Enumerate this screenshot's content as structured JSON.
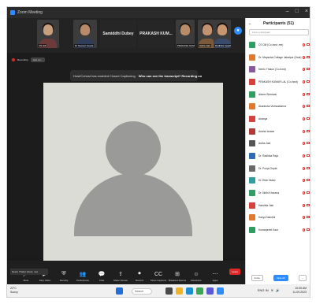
{
  "window": {
    "title": "Zoom Meeting",
    "controls": [
      "–",
      "□",
      "×"
    ]
  },
  "strip": {
    "thumbs": [
      {
        "label": "CS Gill",
        "face": "#c9a07e",
        "hair": "#1a1210",
        "body": "#6b3b3b"
      },
      {
        "label": "Dr Naveen Gupta",
        "face": "#b88a6a",
        "hair": "#1d1714",
        "body": "#2f3d5a"
      },
      {
        "label": "Samiddhi Dubey",
        "face": "#caa080",
        "hair": "#22150f",
        "body": "#5a2c3a"
      },
      {
        "label": "PRAKASH KUMAR LAL",
        "face": "#b98b68",
        "hair": "#1b1410",
        "body": "#3b3b3b"
      },
      {
        "label": "Astha Jain",
        "face": "#c39270",
        "hair": "#1f1410",
        "body": "#7a5a3a"
      },
      {
        "label": "Radhika Upadhyaya",
        "face": "#c7966f",
        "hair": "#150e0b",
        "body": "#3a4a6a"
      }
    ],
    "names": [
      "Samiddhi Dubey",
      "PRAKASH KUM..."
    ],
    "view_label": "View"
  },
  "status": {
    "recording": "Recording",
    "secondary": "Live on..."
  },
  "notice": {
    "text": "Host/Cohost has enabled Closed Captioning",
    "action": "Who can see the transcript? Recording on"
  },
  "speaker": {
    "name": "Neeru Thakur"
  },
  "toolbar": {
    "mini_tile": "Neeru Thakur (Host, me)",
    "items": [
      {
        "icon": "mic-icon",
        "glyph": "🎤",
        "label": "Mute"
      },
      {
        "icon": "video-icon",
        "glyph": "▶",
        "label": "Stop Video"
      },
      {
        "icon": "security-icon",
        "glyph": "⛨",
        "label": "Security"
      },
      {
        "icon": "participants-icon",
        "glyph": "👥",
        "label": "Participants"
      },
      {
        "icon": "chat-icon",
        "glyph": "💬",
        "label": "Chat"
      },
      {
        "icon": "share-screen-icon",
        "glyph": "⇪",
        "label": "Share Screen"
      },
      {
        "icon": "record-icon",
        "glyph": "⏺",
        "label": "Record"
      },
      {
        "icon": "captions-icon",
        "glyph": "CC",
        "label": "Show Captions"
      },
      {
        "icon": "breakout-icon",
        "glyph": "⊞",
        "label": "Breakout Rooms"
      },
      {
        "icon": "reactions-icon",
        "glyph": "☺",
        "label": "Reactions"
      },
      {
        "icon": "apps-icon",
        "glyph": "⋯",
        "label": "Apps"
      }
    ],
    "leave_label": "Leave"
  },
  "panel": {
    "title": "Participants (51)",
    "search_placeholder": "Find a participant",
    "participants": [
      {
        "name": "CS Gill (Co-host, me)",
        "color": "#2f9e62"
      },
      {
        "name": "Dr. Meyasha Cottage Jabalpur (Host)",
        "color": "#e07a2e"
      },
      {
        "name": "Neeru Thakur (Co-host)",
        "color": "#8a5a9e"
      },
      {
        "name": "PRAKASH KUMAR LAL (Co-host)",
        "color": "#d8413b"
      },
      {
        "name": "Aleem Sheriwal",
        "color": "#2f9e62"
      },
      {
        "name": "Akanksha Vishwakarma",
        "color": "#e07a2e"
      },
      {
        "name": "Ananya",
        "color": "#d8413b"
      },
      {
        "name": "Anshul Anwar",
        "color": "#b33939"
      },
      {
        "name": "Astha Jain",
        "color": "#555555"
      },
      {
        "name": "Dr. Radhika Raja",
        "color": "#2f6bb3"
      },
      {
        "name": "Dr. Pooja Gupta",
        "color": "#6a6a6a"
      },
      {
        "name": "Dr. Ekta Yadav",
        "color": "#2f9e9e"
      },
      {
        "name": "Dr. Nidhi Khurana",
        "color": "#2f9e62"
      },
      {
        "name": "Harshita Jain",
        "color": "#d8413b"
      },
      {
        "name": "Kavya Nandini",
        "color": "#e07a2e"
      },
      {
        "name": "Kumarpreet Kaur",
        "color": "#2f9e62"
      }
    ],
    "footer": [
      "Invite",
      "Mute All",
      "..."
    ]
  },
  "taskbar": {
    "weather_temp": "22°C",
    "weather_desc": "Sunny",
    "search": "Search",
    "apps": [
      {
        "icon": "windows-icon",
        "color": "#1f6fd6"
      },
      {
        "icon": "widgets-icon",
        "color": "#4a4a4a"
      },
      {
        "icon": "explorer-icon",
        "color": "#f0b429"
      },
      {
        "icon": "edge-icon",
        "color": "#1c8fd0"
      },
      {
        "icon": "chrome-icon",
        "color": "#3aa757"
      },
      {
        "icon": "teams-icon",
        "color": "#5a5ad6"
      },
      {
        "icon": "zoom-icon",
        "color": "#2d8cff"
      }
    ],
    "tray": "ENG IN",
    "time": "10:05 AM",
    "date": "11-09-2023"
  }
}
